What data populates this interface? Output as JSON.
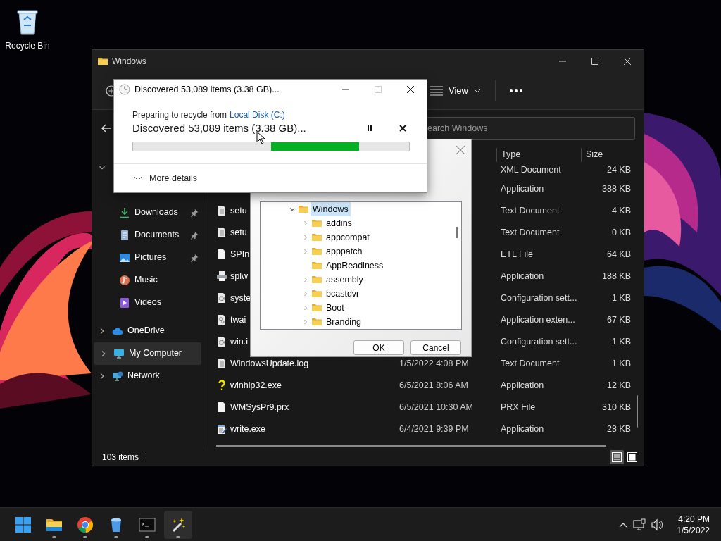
{
  "desktop": {
    "icons": [
      {
        "label": "Recycle Bin",
        "kind": "bin"
      }
    ]
  },
  "explorer": {
    "title": "Windows",
    "view_label": "View",
    "search": {
      "placeholder": "earch Windows"
    },
    "nav": [
      {
        "expanded": true,
        "children": [
          {
            "label": "Downloads",
            "kind": "downloads",
            "pinned": true,
            "selected": false
          },
          {
            "label": "Documents",
            "kind": "documents",
            "pinned": true,
            "selected": false
          },
          {
            "label": "Pictures",
            "kind": "pictures",
            "pinned": true,
            "selected": false
          },
          {
            "label": "Music",
            "kind": "music",
            "pinned": false,
            "selected": false
          },
          {
            "label": "Videos",
            "kind": "videos",
            "pinned": false,
            "selected": false
          }
        ]
      },
      {
        "label": "OneDrive",
        "kind": "cloud",
        "expanded": false,
        "selected": false
      },
      {
        "label": "My Computer",
        "kind": "computer",
        "expanded": false,
        "selected": true
      },
      {
        "label": "Network",
        "kind": "network",
        "expanded": false,
        "selected": false
      }
    ],
    "columns": [
      "Type",
      "Size"
    ],
    "rows": [
      {
        "type": "XML Document",
        "size": "24 KB"
      },
      {
        "type": "Application",
        "size": "388 KB"
      },
      {
        "name": "setu",
        "kind": "text",
        "type": "Text Document",
        "size": "4 KB"
      },
      {
        "name": "setu",
        "kind": "text",
        "type": "Text Document",
        "size": "0 KB"
      },
      {
        "name": "SPIn",
        "kind": "blank",
        "type": "ETL File",
        "size": "64 KB"
      },
      {
        "name": "splw",
        "kind": "printer",
        "type": "Application",
        "size": "188 KB"
      },
      {
        "name": "syste",
        "kind": "config",
        "type": "Configuration sett...",
        "size": "1 KB"
      },
      {
        "name": "twai",
        "kind": "extension",
        "type": "Application exten...",
        "size": "67 KB"
      },
      {
        "name": "win.i",
        "kind": "config",
        "type": "Configuration sett...",
        "size": "1 KB"
      },
      {
        "name": "WindowsUpdate.log",
        "kind": "text",
        "date": "1/5/2022 4:08 PM",
        "type": "Text Document",
        "size": "1 KB"
      },
      {
        "name": "winhlp32.exe",
        "kind": "help",
        "date": "6/5/2021 8:06 AM",
        "type": "Application",
        "size": "12 KB"
      },
      {
        "name": "WMSysPr9.prx",
        "kind": "blank",
        "date": "6/5/2021 10:30 AM",
        "type": "PRX File",
        "size": "310 KB"
      },
      {
        "name": "write.exe",
        "kind": "notepad",
        "date": "6/4/2021 9:39 PM",
        "type": "Application",
        "size": "28 KB"
      }
    ],
    "status": "103 items",
    "view_modes": [
      {
        "kind": "details",
        "selected": true
      },
      {
        "kind": "tiles",
        "selected": false
      }
    ]
  },
  "folder_dialog": {
    "tree": [
      {
        "label": "Windows",
        "expanded": true,
        "selected": true,
        "children": [
          {
            "label": "addins",
            "expandable": true
          },
          {
            "label": "appcompat",
            "expandable": true
          },
          {
            "label": "apppatch",
            "expandable": true
          },
          {
            "label": "AppReadiness",
            "expandable": false
          },
          {
            "label": "assembly",
            "expandable": true
          },
          {
            "label": "bcastdvr",
            "expandable": true
          },
          {
            "label": "Boot",
            "expandable": true
          },
          {
            "label": "Branding",
            "expandable": true
          }
        ]
      }
    ],
    "buttons": [
      "OK",
      "Cancel"
    ]
  },
  "progress_dialog": {
    "title": "Discovered 53,089 items (3.38 GB)...",
    "maximize_disabled": true,
    "source_prefix": "Preparing to recycle from",
    "source_link": "Local Disk (C:)",
    "status": "Discovered 53,089 items (3.38 GB)...",
    "indeterminate": true,
    "details_label": "More details"
  },
  "taskbar": {
    "apps": [
      {
        "kind": "start",
        "running": false,
        "selected": false
      },
      {
        "kind": "explorer",
        "running": true,
        "selected": false
      },
      {
        "kind": "browser",
        "running": true,
        "selected": false
      },
      {
        "kind": "bin",
        "running": true,
        "selected": false
      },
      {
        "kind": "terminal",
        "running": true,
        "selected": false
      },
      {
        "kind": "wand",
        "running": true,
        "selected": true
      }
    ],
    "time": "4:20 PM",
    "date": "1/5/2022"
  }
}
